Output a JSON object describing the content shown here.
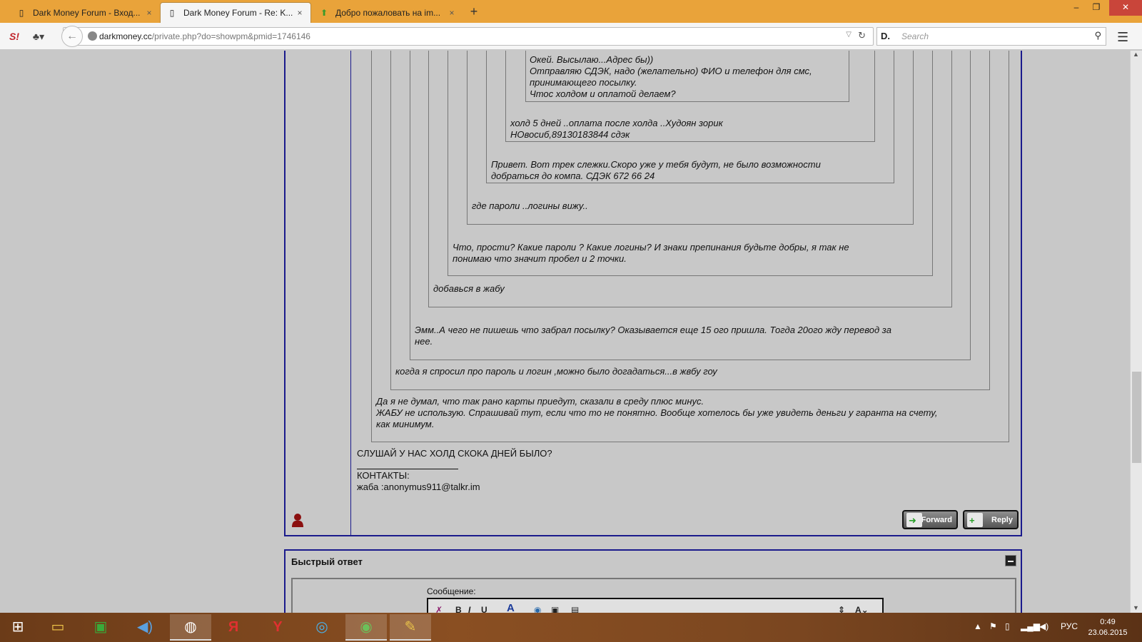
{
  "browser": {
    "tabs": [
      {
        "title": "Dark Money Forum - Вход...",
        "active": false
      },
      {
        "title": "Dark Money Forum - Re: K...",
        "active": true
      },
      {
        "title": "Добро пожаловать на im...",
        "active": false
      }
    ],
    "new_tab": "+",
    "close_tab": "×",
    "window_controls": {
      "minimize": "–",
      "maximize": "❐",
      "close": "✕"
    },
    "url_host": "darkmoney.cc",
    "url_path": "/private.php?do=showpm&pmid=1746146",
    "search_engine": "D.",
    "search_placeholder": "Search"
  },
  "post": {
    "quotes": [
      "Окей. Высылаю...Адрес бы))\nОтправляю СДЭК, надо (желательно) ФИО и телефон для смс,\nпринимающего посылку.\nЧтос холдом и оплатой делаем?",
      "холд 5 дней ..оплата после холда ..Худоян зорик\nНОвосиб,89130183844 сдэк",
      "Привет. Вот трек слежки.Скоро уже у тебя будут, не было возможности\nдобраться до компа. СДЭК 672 66 24",
      "где пароли ..логины вижу..",
      "Что, прости? Какие пароли ? Какие логины? И знаки препинания будьте добры, я так не\nпонимаю что значит пробел и 2 точки.",
      "добавься в жабу",
      "Эмм..А чего не пишешь что забрал посылку? Оказывается еще 15 ого пришла. Тогда 20ого жду перевод за\nнее.",
      "когда я спросил про пароль и логин ,можно было догадаться...в жвбу гоу",
      "Да я не думал, что так рано карты приедут, сказали в среду плюс минус.\nЖАБУ не использую. Спрашивай тут, если что то не понятно. Вообще хотелось бы уже увидеть деньги у гаранта на счету,\nкак минимум."
    ],
    "message": "СЛУШАЙ У НАС ХОЛД СКОКА ДНЕЙ БЫЛО?",
    "signature": "КОНТАКТЫ:\nжаба :anonymus911@talkr.im",
    "forward_label": "Forward",
    "reply_label": "Reply"
  },
  "quick_reply": {
    "title": "Быстрый ответ",
    "message_label": "Сообщение:"
  },
  "taskbar": {
    "lang": "РУС",
    "time": "0:49",
    "date": "23.06.2015"
  }
}
